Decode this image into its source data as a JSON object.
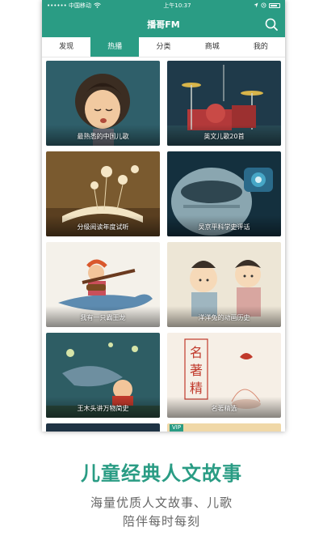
{
  "status_bar": {
    "carrier": "•••••• 中国移动",
    "time": "上午10:37"
  },
  "nav": {
    "title": "播哥FM"
  },
  "tabs": [
    {
      "label": "发现"
    },
    {
      "label": "热播"
    },
    {
      "label": "分类"
    },
    {
      "label": "商城"
    },
    {
      "label": "我的"
    }
  ],
  "cards": [
    {
      "label": "最熟悉的中国儿歌"
    },
    {
      "label": "英文儿歌20首"
    },
    {
      "label": "分级阅读年度试听"
    },
    {
      "label": "吴京平科学史评话"
    },
    {
      "label": "我有一只霸王龙"
    },
    {
      "label": "洋洋兔的动画历史"
    },
    {
      "label": "王木头讲万物简史"
    },
    {
      "label": "名著精选"
    }
  ],
  "badge": "VIP",
  "promo": {
    "headline": "儿童经典人文故事",
    "line1": "海量优质人文故事、儿歌",
    "line2": "陪伴每时每刻"
  },
  "colors": {
    "accent": "#2a9c84"
  }
}
